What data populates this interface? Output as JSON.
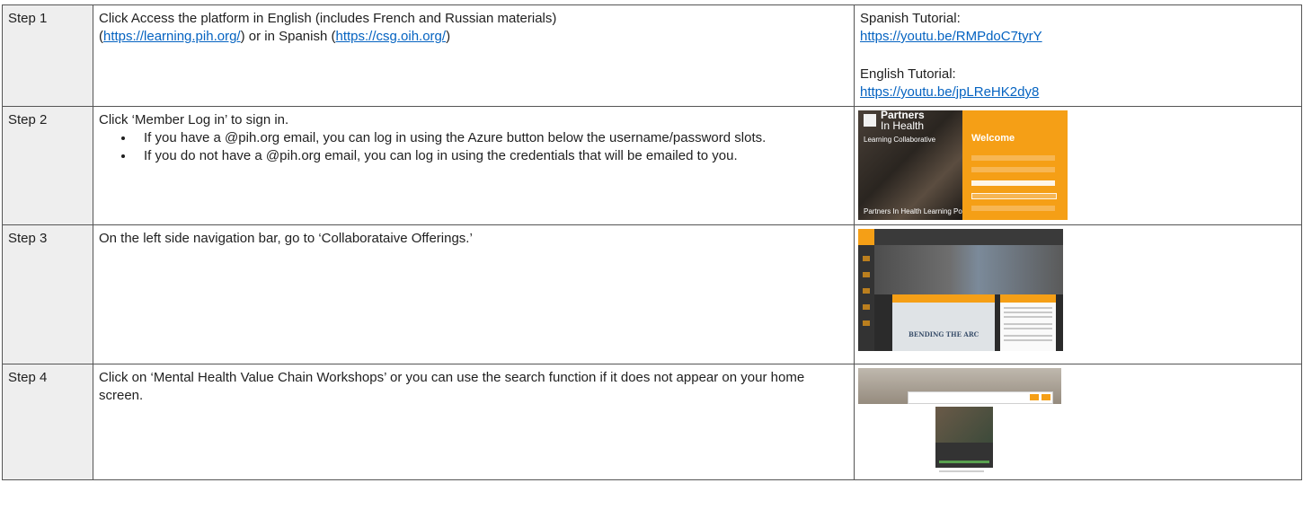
{
  "steps": [
    {
      "label": "Step 1",
      "line1": "Click Access the platform in English (includes French and Russian materials)",
      "line2_open": "(",
      "link_english": "https://learning.pih.org/",
      "line2_mid": ") or in Spanish (",
      "link_spanish": "https://csg.oih.org/",
      "line2_close": ")",
      "tutorials": {
        "spanish_label": "Spanish Tutorial:",
        "spanish_url": "https://youtu.be/RMPdoC7tyrY",
        "english_label": "English Tutorial:",
        "english_url": "https://youtu.be/jpLReHK2dy8"
      }
    },
    {
      "label": "Step 2",
      "text": "Click ‘Member Log in’ to sign in.",
      "bullets": [
        "If you have a @pih.org email, you can log in using the Azure button below the username/password slots.",
        "If you do not have a @pih.org email, you can log in using the credentials that will be emailed to you."
      ],
      "thumbnail": {
        "logo_line1": "Partners",
        "logo_line2": "In Health",
        "collab": "Learning Collaborative",
        "welcome": "Welcome",
        "portal_name": "Partners In Health Learning Portal"
      }
    },
    {
      "label": "Step 3",
      "text": "On the left side navigation bar, go to ‘Collaborataive Offerings.’",
      "thumbnail": {
        "card_text": "BENDING THE ARC"
      }
    },
    {
      "label": "Step 4",
      "text": "Click on ‘Mental Health Value Chain Workshops’ or you can use the search function if it does not appear on your home screen."
    }
  ],
  "colors": {
    "link": "#0563c1",
    "label_bg": "#eeeeee",
    "accent_orange": "#f59f16"
  }
}
